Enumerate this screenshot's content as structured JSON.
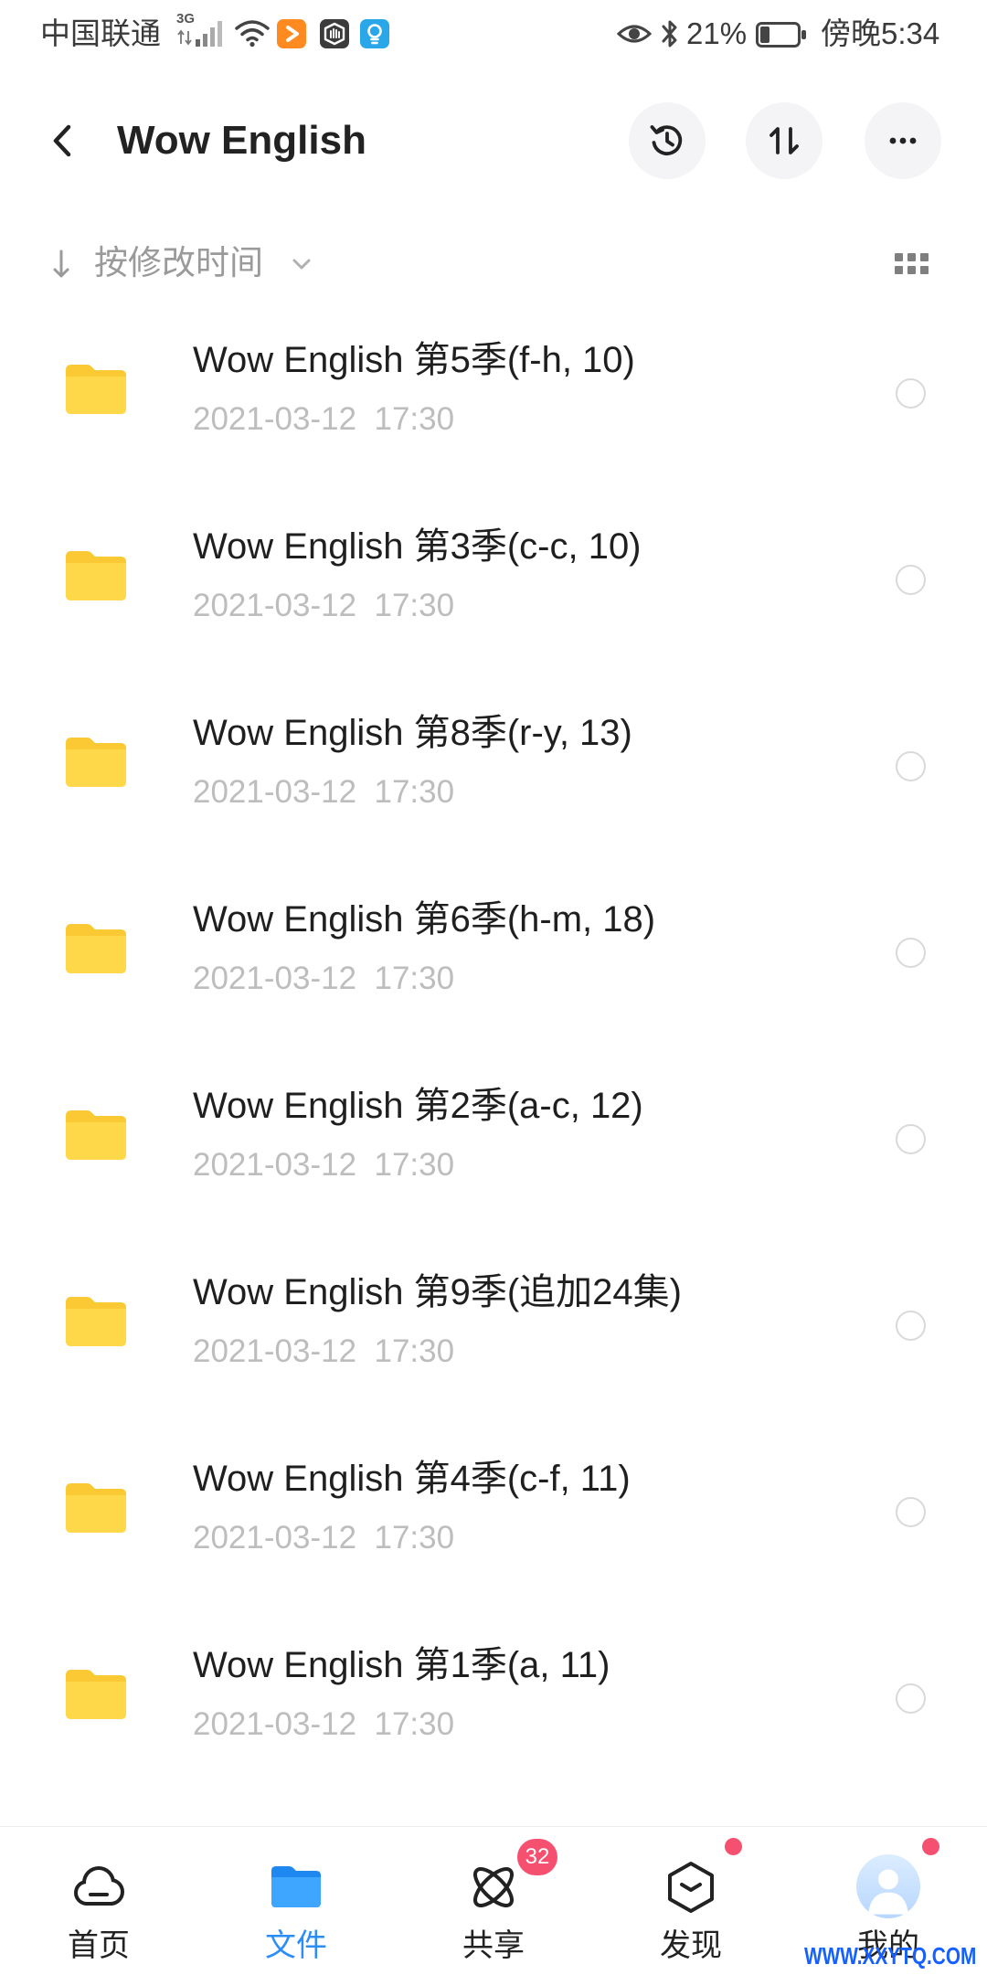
{
  "status_bar": {
    "carrier": "中国联通",
    "network": "3G",
    "battery": "21%",
    "time": "傍晚5:34",
    "icons": [
      "signal-icon",
      "wifi-icon",
      "orange-app-icon",
      "shield-app-icon",
      "lightbulb-app-icon",
      "eye-icon",
      "bluetooth-icon",
      "battery-icon"
    ]
  },
  "header": {
    "title": "Wow English",
    "buttons": [
      "history-icon",
      "sort-arrows-icon",
      "more-icon"
    ]
  },
  "sort": {
    "label": "按修改时间"
  },
  "files": [
    {
      "name": "Wow English 第5季(f-h, 10)",
      "modified": "2021-03-12  17:30"
    },
    {
      "name": "Wow English 第3季(c-c, 10)",
      "modified": "2021-03-12  17:30"
    },
    {
      "name": "Wow English 第8季(r-y, 13)",
      "modified": "2021-03-12  17:30"
    },
    {
      "name": "Wow English 第6季(h-m, 18)",
      "modified": "2021-03-12  17:30"
    },
    {
      "name": "Wow English 第2季(a-c, 12)",
      "modified": "2021-03-12  17:30"
    },
    {
      "name": "Wow English 第9季(追加24集)",
      "modified": "2021-03-12  17:30"
    },
    {
      "name": "Wow English 第4季(c-f, 11)",
      "modified": "2021-03-12  17:30"
    },
    {
      "name": "Wow English 第1季(a, 11)",
      "modified": "2021-03-12  17:30"
    }
  ],
  "bottom_nav": {
    "items": [
      {
        "label": "首页",
        "icon": "cloud-icon"
      },
      {
        "label": "文件",
        "icon": "folder-icon",
        "active": true
      },
      {
        "label": "共享",
        "icon": "atom-icon",
        "badge": "32"
      },
      {
        "label": "发现",
        "icon": "hexagon-box-icon",
        "dot": true
      },
      {
        "label": "我的",
        "icon": "avatar-icon",
        "dot": true
      }
    ]
  },
  "watermark": "WWW.XXYTQ.COM",
  "colors": {
    "accent": "#2b8df5",
    "folder_back": "#fbc934",
    "folder_front": "#ffd84a",
    "badge": "#f5506f",
    "muted": "#bdbdbd",
    "sort_text": "#9a9a9a",
    "button_bg": "#f4f4f6"
  }
}
